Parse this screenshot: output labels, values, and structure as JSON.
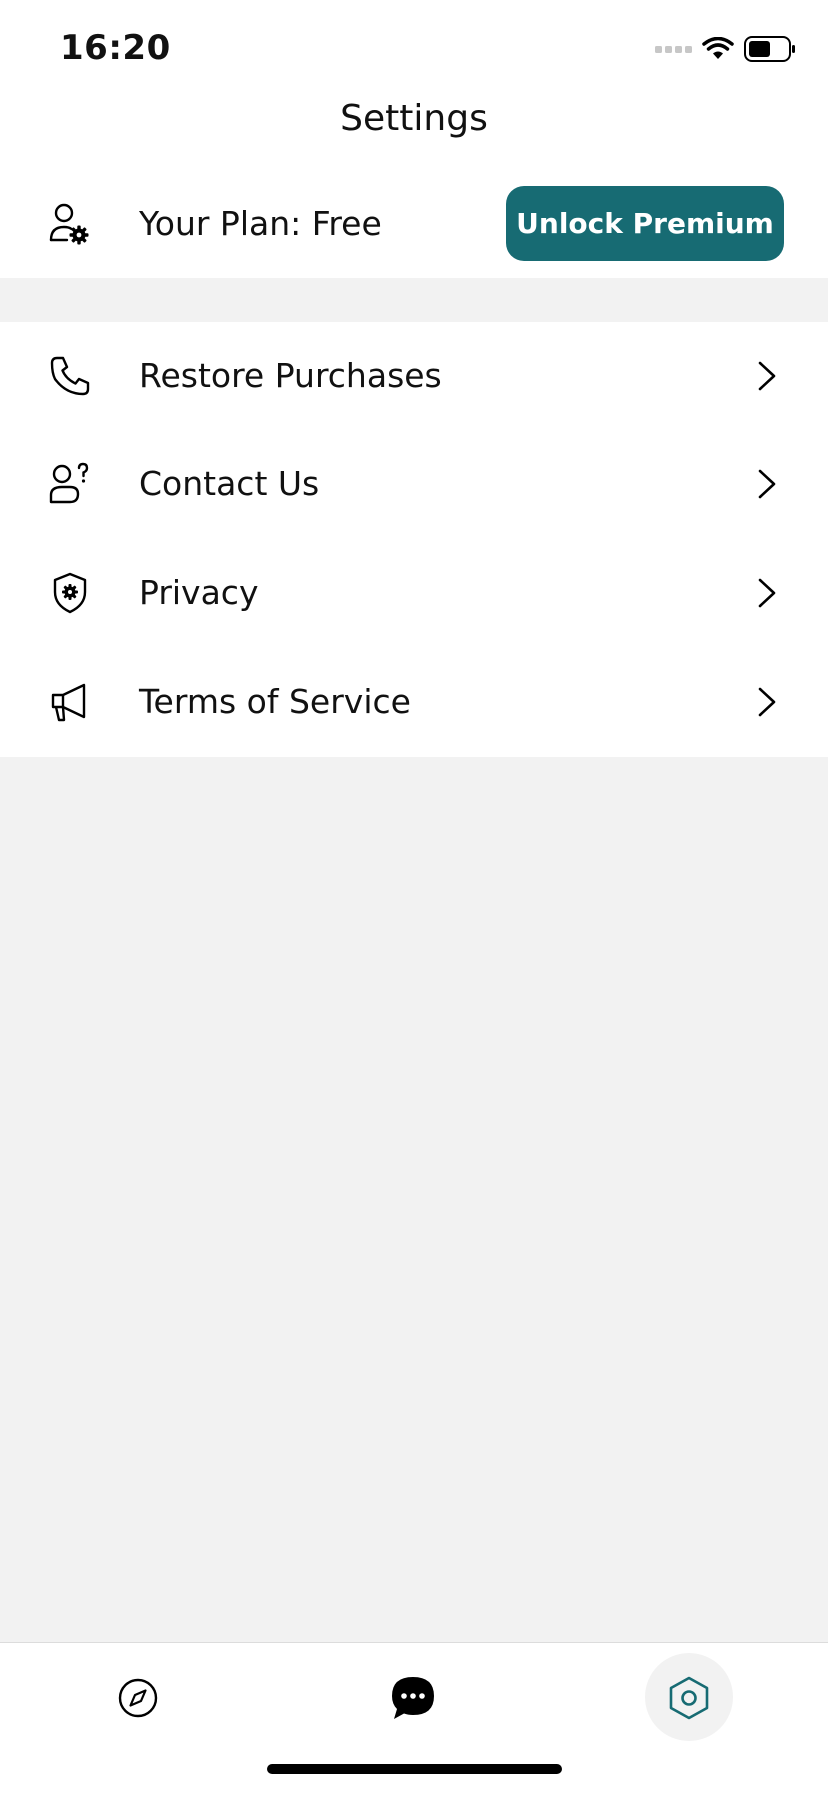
{
  "status_bar": {
    "time": "16:20"
  },
  "header": {
    "title": "Settings"
  },
  "plan": {
    "label": "Your Plan: Free",
    "button_label": "Unlock Premium",
    "icon": "user-settings-icon"
  },
  "menu": {
    "items": [
      {
        "label": "Restore Purchases",
        "icon": "phone-icon"
      },
      {
        "label": "Contact Us",
        "icon": "user-question-icon"
      },
      {
        "label": "Privacy",
        "icon": "shield-gear-icon"
      },
      {
        "label": "Terms of Service",
        "icon": "megaphone-icon"
      }
    ]
  },
  "tab_bar": {
    "tabs": [
      {
        "icon": "compass-icon",
        "active": false
      },
      {
        "icon": "chat-bubble-icon",
        "active": false
      },
      {
        "icon": "hexagon-settings-icon",
        "active": true
      }
    ]
  },
  "colors": {
    "accent": "#176b73",
    "background": "#f2f2f2",
    "surface": "#ffffff"
  }
}
